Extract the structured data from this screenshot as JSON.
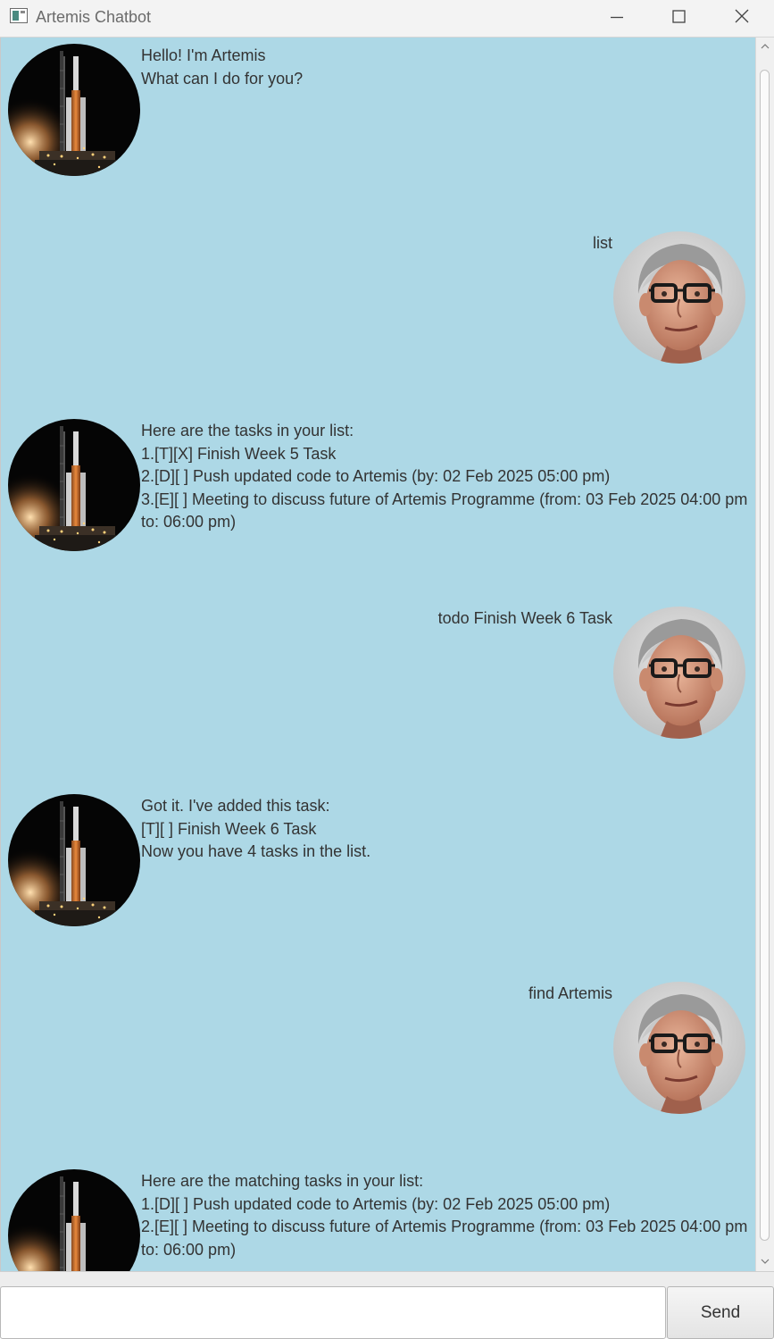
{
  "window": {
    "title": "Artemis Chatbot",
    "icons": {
      "app": "app-window-icon",
      "minimize": "minimize-icon",
      "maximize": "maximize-icon",
      "close": "close-icon"
    }
  },
  "colors": {
    "chat_background": "#add8e6",
    "text": "#333333"
  },
  "messages": [
    {
      "sender": "bot",
      "avatar": "rocket-launch-avatar",
      "text": "Hello! I'm Artemis\nWhat can I do for you?"
    },
    {
      "sender": "user",
      "avatar": "user-portrait-avatar",
      "text": "list"
    },
    {
      "sender": "bot",
      "avatar": "rocket-launch-avatar",
      "text": "Here are the tasks in your list:\n1.[T][X] Finish Week 5 Task\n2.[D][ ] Push updated code to Artemis (by: 02 Feb 2025 05:00 pm)\n3.[E][ ] Meeting to discuss future of Artemis Programme (from: 03 Feb 2025 04:00 pm to: 06:00 pm)"
    },
    {
      "sender": "user",
      "avatar": "user-portrait-avatar",
      "text": "todo Finish Week 6 Task"
    },
    {
      "sender": "bot",
      "avatar": "rocket-launch-avatar",
      "text": "Got it. I've added this task:\n[T][ ] Finish Week 6 Task\nNow you have 4 tasks in the list."
    },
    {
      "sender": "user",
      "avatar": "user-portrait-avatar",
      "text": "find Artemis"
    },
    {
      "sender": "bot",
      "avatar": "rocket-launch-avatar",
      "text": "Here are the matching tasks in your list:\n1.[D][ ] Push updated code to Artemis (by: 02 Feb 2025 05:00 pm)\n2.[E][ ] Meeting to discuss future of Artemis Programme (from: 03 Feb 2025 04:00 pm to: 06:00 pm)"
    }
  ],
  "input": {
    "value": "",
    "placeholder": ""
  },
  "send_button": {
    "label": "Send"
  }
}
